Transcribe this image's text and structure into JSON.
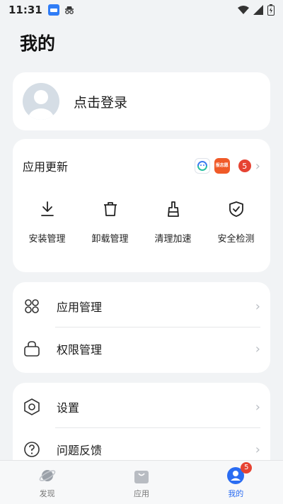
{
  "status_bar": {
    "time": "11:31"
  },
  "page": {
    "title": "我的"
  },
  "login": {
    "label": "点击登录"
  },
  "app_update": {
    "title": "应用更新",
    "mini_app_b_text": "报志愿",
    "count": "5",
    "tools": [
      {
        "label": "安装管理",
        "icon": "download-icon"
      },
      {
        "label": "卸载管理",
        "icon": "trash-icon"
      },
      {
        "label": "清理加速",
        "icon": "broom-icon"
      },
      {
        "label": "安全检测",
        "icon": "shield-check-icon"
      }
    ]
  },
  "manage": {
    "items": [
      {
        "label": "应用管理",
        "icon": "app-grid-icon"
      },
      {
        "label": "权限管理",
        "icon": "lock-icon"
      }
    ]
  },
  "settings": {
    "items": [
      {
        "label": "设置",
        "icon": "settings-hex-icon"
      },
      {
        "label": "问题反馈",
        "icon": "help-circle-icon"
      }
    ]
  },
  "bottom_nav": {
    "items": [
      {
        "label": "发现",
        "icon": "planet-icon"
      },
      {
        "label": "应用",
        "icon": "bag-icon"
      },
      {
        "label": "我的",
        "icon": "user-icon",
        "badge": "5",
        "active": true
      }
    ]
  },
  "colors": {
    "accent": "#2a6cf2",
    "badge": "#e64332",
    "background": "#f1f3f5"
  }
}
